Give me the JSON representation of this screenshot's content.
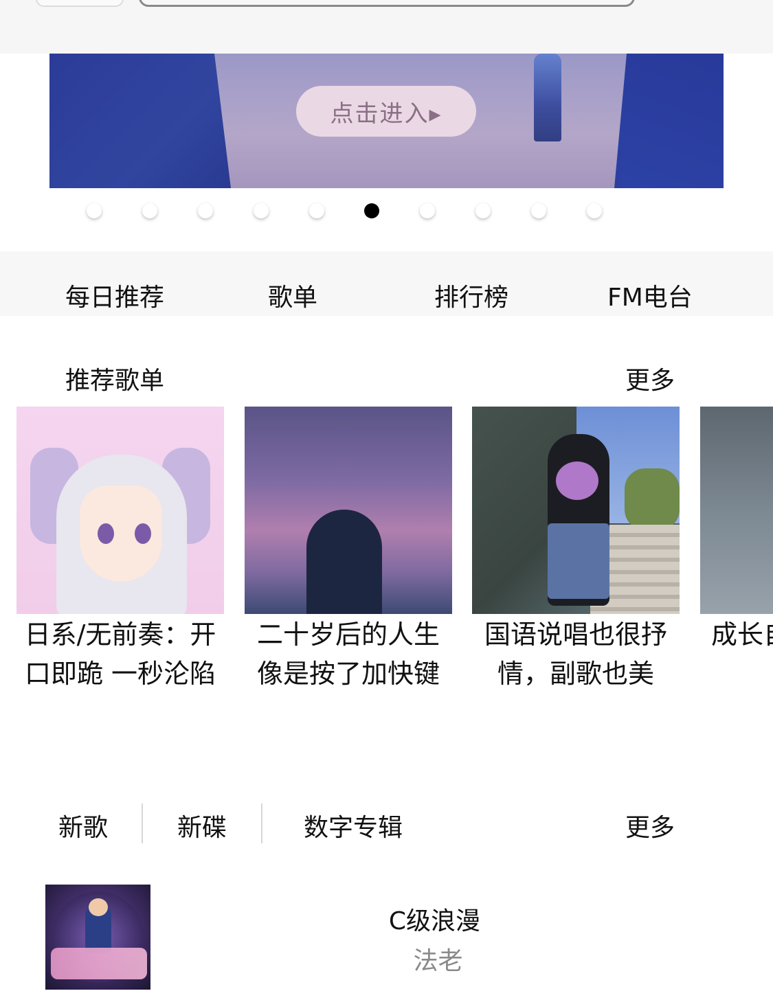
{
  "banner": {
    "enter_label": "点击进入▸",
    "dot_count": 10,
    "active_dot": 5
  },
  "nav": {
    "items": [
      "每日推荐",
      "歌单",
      "排行榜",
      "FM电台"
    ]
  },
  "recommend": {
    "title": "推荐歌单",
    "more_label": "更多",
    "playlists": [
      {
        "title": "日系/无前奏：开口即跪 一秒沦陷"
      },
      {
        "title": "二十岁后的人生像是按了加快键"
      },
      {
        "title": "国语说唱也很抒情，副歌也美"
      },
      {
        "title": "成长自己"
      }
    ]
  },
  "new_music": {
    "tabs": [
      "新歌",
      "新碟",
      "数字专辑"
    ],
    "more_label": "更多",
    "songs": [
      {
        "title": "C级浪漫",
        "artist": "法老"
      }
    ]
  }
}
